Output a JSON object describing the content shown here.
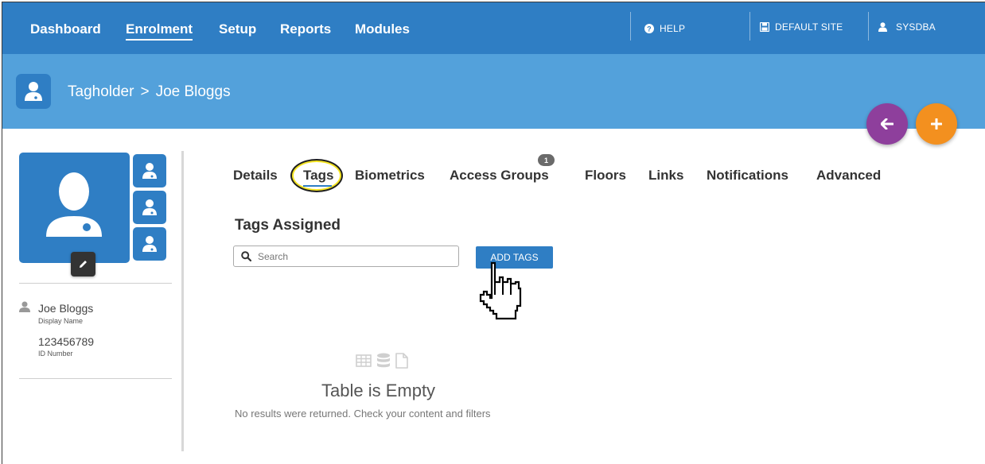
{
  "nav": {
    "items": [
      {
        "label": "Dashboard"
      },
      {
        "label": "Enrolment"
      },
      {
        "label": "Setup"
      },
      {
        "label": "Reports"
      },
      {
        "label": "Modules"
      }
    ],
    "help": "HELP",
    "site": "DEFAULT SITE",
    "user": "SYSDBA"
  },
  "header": {
    "crumb_parent": "Tagholder",
    "crumb_separator": ">",
    "crumb_current": "Joe Bloggs"
  },
  "profile": {
    "display_name": "Joe Bloggs",
    "display_name_caption": "Display Name",
    "id_number": "123456789",
    "id_number_caption": "ID Number"
  },
  "tabs": [
    {
      "label": "Details"
    },
    {
      "label": "Tags"
    },
    {
      "label": "Biometrics"
    },
    {
      "label": "Access Groups"
    },
    {
      "label": "Floors"
    },
    {
      "label": "Links"
    },
    {
      "label": "Notifications"
    },
    {
      "label": "Advanced"
    }
  ],
  "access_groups_badge": "1",
  "tags_panel": {
    "title": "Tags Assigned",
    "search_placeholder": "Search",
    "add_button": "ADD TAGS",
    "empty_title": "Table is Empty",
    "empty_subtitle": "No results were returned. Check your content and filters"
  },
  "colors": {
    "primary": "#2f7ec4",
    "header": "#53a1db",
    "back_fab": "#8e3f9c",
    "add_fab": "#f3901f",
    "highlight": "#f4e422"
  },
  "icons": [
    "question-circle-icon",
    "save-icon",
    "user-icon",
    "person-icon",
    "arrow-left-icon",
    "plus-icon",
    "pencil-icon",
    "search-icon",
    "table-icon",
    "database-icon",
    "file-icon",
    "hand-pointer-icon"
  ]
}
